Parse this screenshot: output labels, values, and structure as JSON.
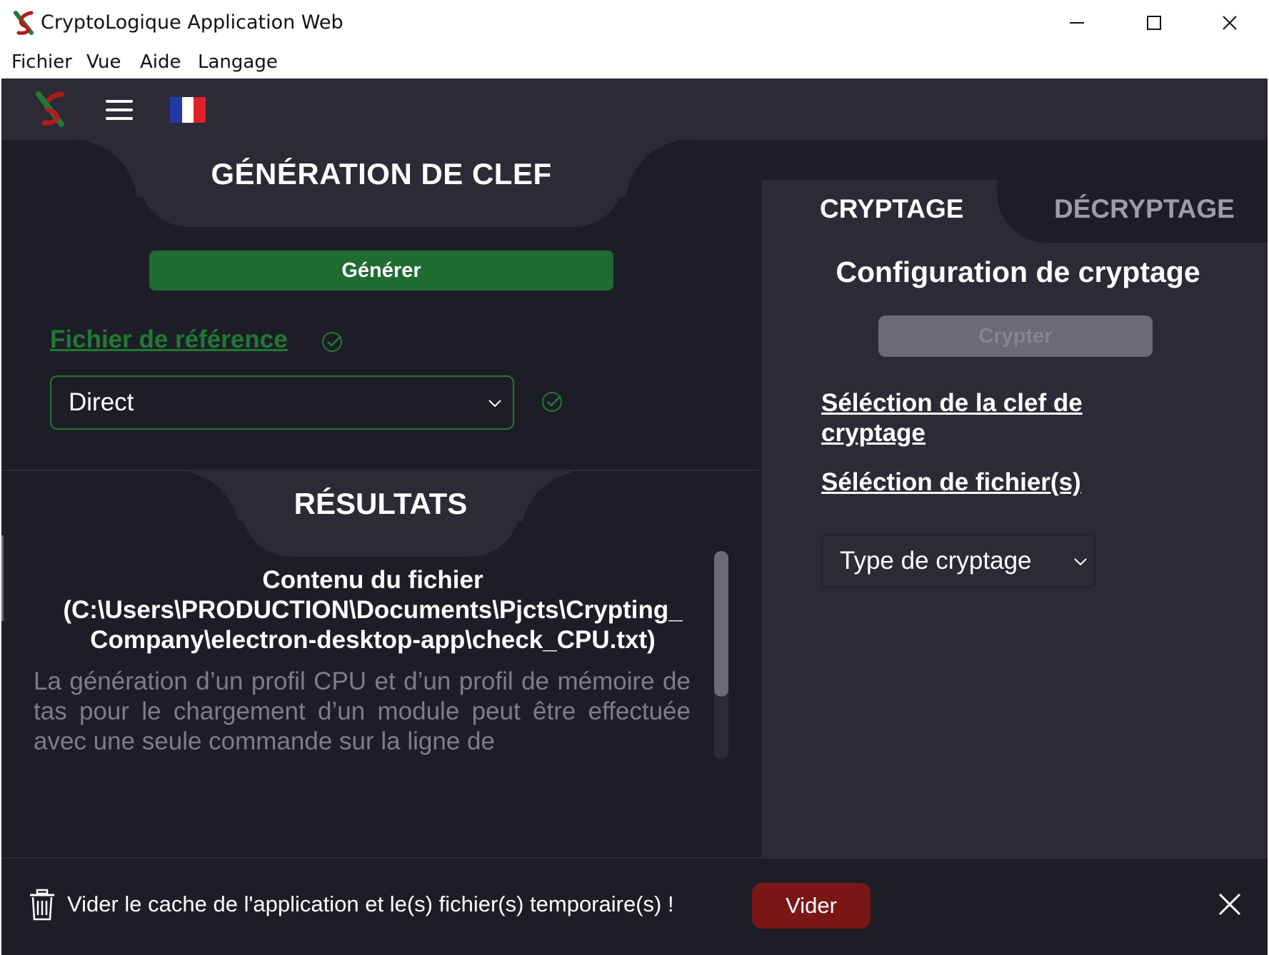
{
  "window": {
    "title": "CryptoLogique Application Web",
    "minimize_icon": "minimize-icon",
    "maximize_icon": "maximize-icon",
    "close_icon": "close-icon"
  },
  "menubar": {
    "items": [
      {
        "label": "Fichier"
      },
      {
        "label": "Vue"
      },
      {
        "label": "Aide"
      },
      {
        "label": "Langage"
      }
    ]
  },
  "topnav": {
    "logo_icon": "app-logo-icon",
    "menu_icon": "hamburger-icon",
    "flag_icon": "france-flag-icon",
    "flag_colors": [
      "#1f3aa8",
      "#ffffff",
      "#e0202a"
    ]
  },
  "generation": {
    "title": "GÉNÉRATION DE CLEF",
    "generate_label": "Générer",
    "reference_link": "Fichier de référence",
    "reference_status_icon": "check-circle-icon",
    "mode_select_value": "Direct",
    "mode_status_icon": "check-circle-icon"
  },
  "results": {
    "title": "RÉSULTATS",
    "file_heading": "Contenu du fichier (C:\\Users\\PRODUCTION\\Documents\\Pjcts\\Crypting_ Company\\electron-desktop-app\\check_CPU.txt)",
    "file_body": "La génération d’un profil CPU et d’un profil de mémoire de tas pour le chargement d’un module peut être effectuée avec une seule commande sur la ligne de"
  },
  "crypt": {
    "tabs": [
      {
        "label": "CRYPTAGE",
        "active": true
      },
      {
        "label": "DÉCRYPTAGE",
        "active": false
      }
    ],
    "config_title": "Configuration de cryptage",
    "crypt_button": "Crypter",
    "key_link": "Séléction de la clef de cryptage",
    "files_link": "Séléction de fichier(s)",
    "type_select_value": "Type de cryptage"
  },
  "banner": {
    "icon": "trash-icon",
    "message": "Vider le cache de l'application et le(s) fichier(s) temporaire(s) !",
    "button": "Vider",
    "close_icon": "close-icon"
  },
  "colors": {
    "background": "#1d1d27",
    "panel": "#2b2a37",
    "accent_green": "#1f6b32",
    "danger": "#7b1616",
    "muted_text": "#7e7e88"
  }
}
